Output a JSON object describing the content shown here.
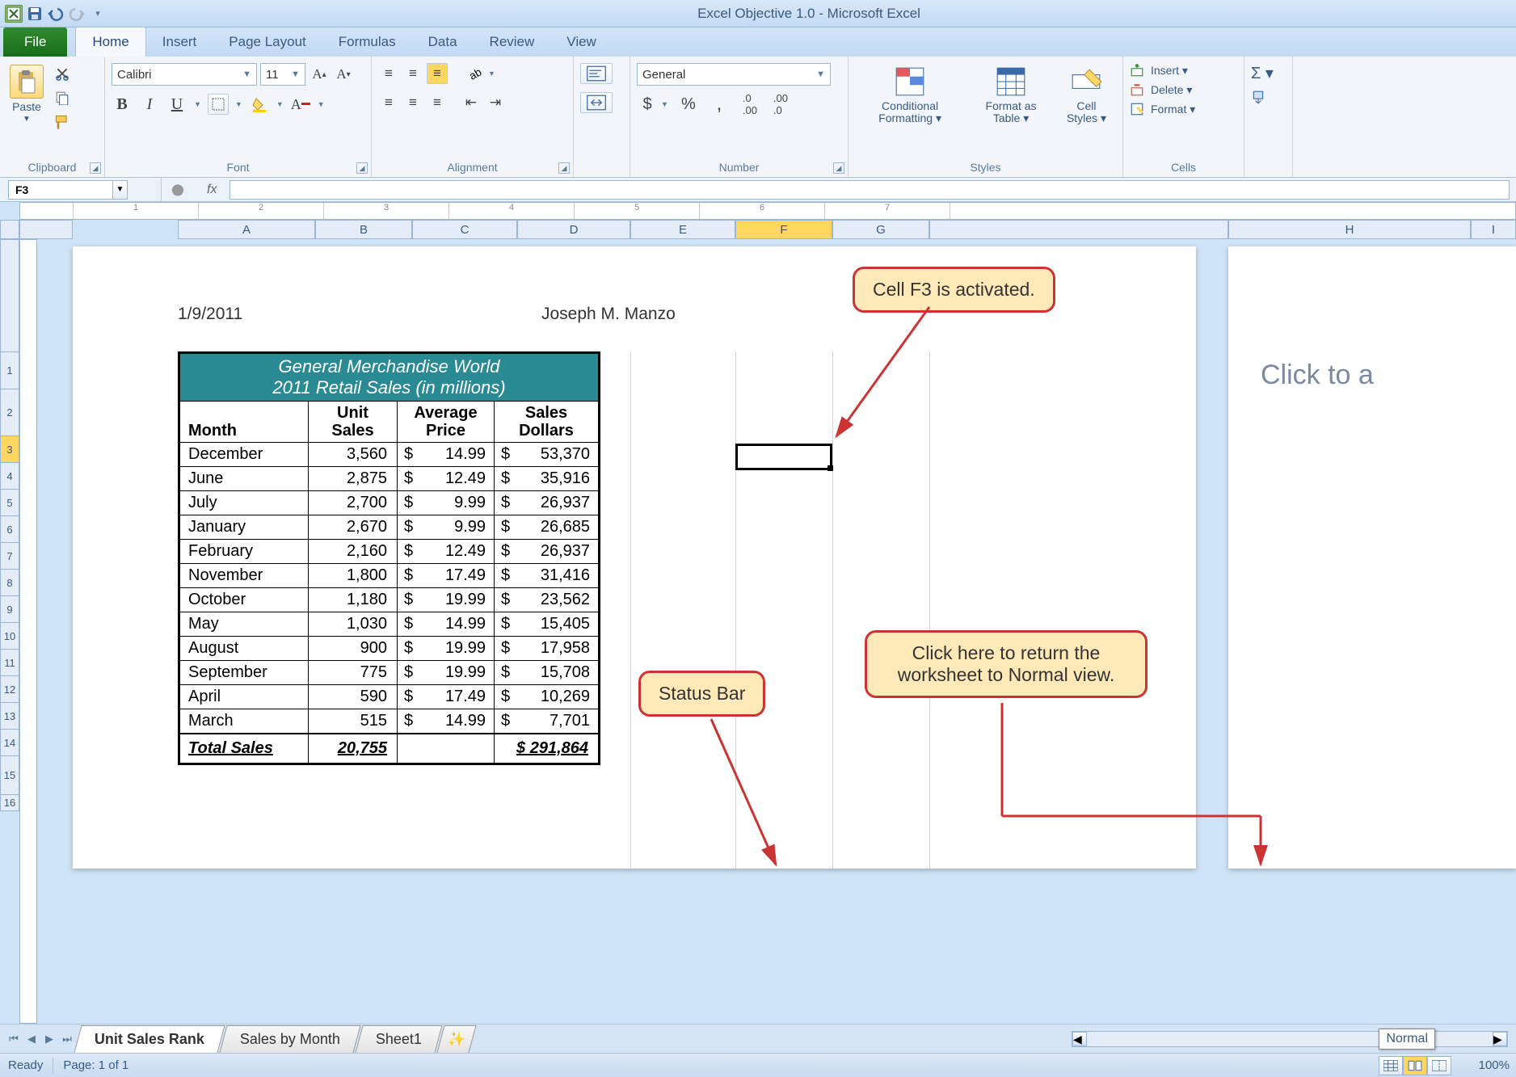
{
  "title": "Excel Objective 1.0  -  Microsoft Excel",
  "ribbon": {
    "file": "File",
    "tabs": [
      "Home",
      "Insert",
      "Page Layout",
      "Formulas",
      "Data",
      "Review",
      "View"
    ],
    "active_tab": "Home",
    "clipboard": {
      "paste": "Paste",
      "group": "Clipboard"
    },
    "font": {
      "name": "Calibri",
      "size": "11",
      "group": "Font",
      "bold": "B",
      "italic": "I",
      "underline": "U"
    },
    "alignment": {
      "group": "Alignment"
    },
    "number": {
      "format": "General",
      "group": "Number"
    },
    "styles": {
      "conditional": "Conditional Formatting ▾",
      "format_table": "Format as Table ▾",
      "cell_styles": "Cell Styles ▾",
      "group": "Styles"
    },
    "cells": {
      "insert": "Insert ▾",
      "delete": "Delete ▾",
      "format": "Format ▾",
      "group": "Cells"
    }
  },
  "namebox": "F3",
  "fx": "fx",
  "columns": [
    "A",
    "B",
    "C",
    "D",
    "E",
    "F",
    "G",
    "H",
    "I"
  ],
  "rows": [
    "1",
    "2",
    "3",
    "4",
    "5",
    "6",
    "7",
    "8",
    "9",
    "10",
    "11",
    "12",
    "13",
    "14",
    "15",
    "16"
  ],
  "page": {
    "date": "1/9/2011",
    "author": "Joseph M. Manzo",
    "title1": "General Merchandise World",
    "title2": "2011 Retail Sales (in millions)",
    "headers": [
      "Month",
      "Unit Sales",
      "Average Price",
      "Sales Dollars"
    ],
    "rows": [
      [
        "December",
        "3,560",
        "14.99",
        "53,370"
      ],
      [
        "June",
        "2,875",
        "12.49",
        "35,916"
      ],
      [
        "July",
        "2,700",
        "9.99",
        "26,937"
      ],
      [
        "January",
        "2,670",
        "9.99",
        "26,685"
      ],
      [
        "February",
        "2,160",
        "12.49",
        "26,937"
      ],
      [
        "November",
        "1,800",
        "17.49",
        "31,416"
      ],
      [
        "October",
        "1,180",
        "19.99",
        "23,562"
      ],
      [
        "May",
        "1,030",
        "14.99",
        "15,405"
      ],
      [
        "August",
        "900",
        "19.99",
        "17,958"
      ],
      [
        "September",
        "775",
        "19.99",
        "15,708"
      ],
      [
        "April",
        "590",
        "17.49",
        "10,269"
      ],
      [
        "March",
        "515",
        "14.99",
        "7,701"
      ]
    ],
    "total_label": "Total Sales",
    "total_units": "20,755",
    "total_dollars": "$   291,864",
    "next_page_hint": "Click to a"
  },
  "callouts": {
    "f3": "Cell F3 is activated.",
    "statusbar": "Status Bar",
    "normal_view": "Click here to return the worksheet to Normal view."
  },
  "sheets": {
    "tabs": [
      "Unit Sales Rank",
      "Sales by Month",
      "Sheet1"
    ],
    "active": 0
  },
  "status": {
    "ready": "Ready",
    "page": "Page: 1 of 1",
    "zoom": "100%",
    "tooltip": "Normal"
  }
}
